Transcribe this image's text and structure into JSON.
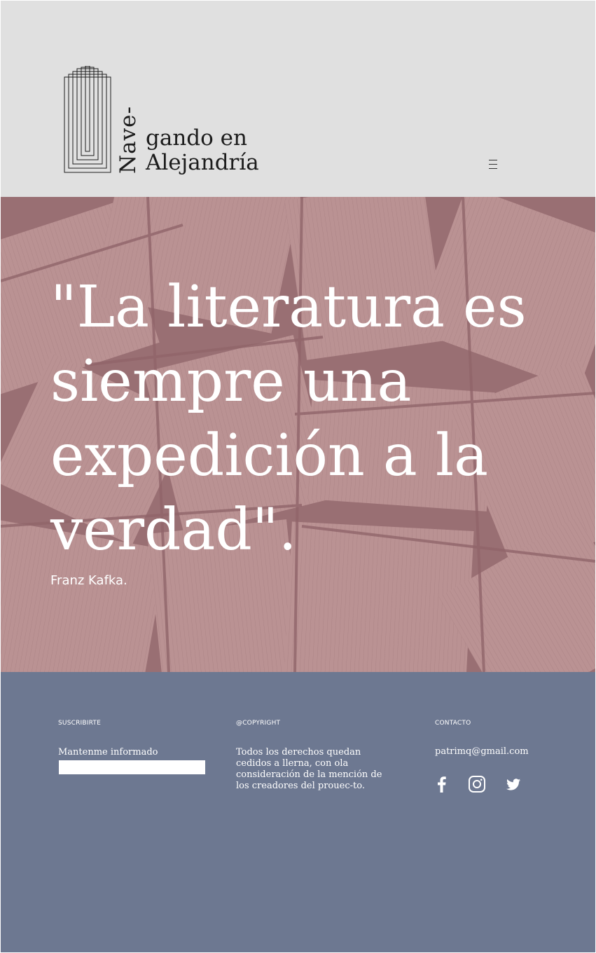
{
  "header": {
    "logo_vertical": "Nave-",
    "logo_line_1": "gando en",
    "logo_line_2": "Alejandría"
  },
  "hero": {
    "quote": "\"La literatura es siempre una expedición a la verdad\".",
    "author": "Franz Kafka."
  },
  "footer": {
    "subscribe": {
      "heading": "SUSCRIBIRTE",
      "label": "Mantenme informado",
      "input_value": ""
    },
    "copyright": {
      "heading": "@COPYRIGHT",
      "text": "Todos los derechos quedan cedidos a llerna, con ola consideración de la mención de los creadores del prouec-to."
    },
    "contact": {
      "heading": "CONTACTO",
      "email": "patrimq@gmail.com",
      "social_icons": [
        "facebook-icon",
        "instagram-icon",
        "twitter-icon"
      ]
    }
  },
  "colors": {
    "header_bg": "#e0e0e0",
    "hero_tint": "#a67c80",
    "footer_bg": "#6d7891",
    "text_light": "#ffffff",
    "text_dark": "#1c1c1c"
  }
}
